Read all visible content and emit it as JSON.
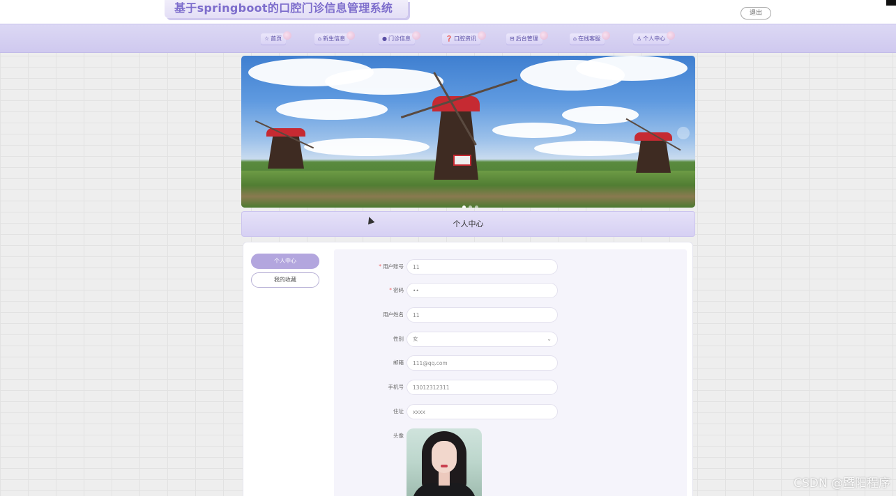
{
  "header": {
    "site_title": "基于springboot的口腔门诊信息管理系统",
    "logout_label": "退出"
  },
  "nav": {
    "items": [
      {
        "icon": "☆",
        "label": "首页"
      },
      {
        "icon": "⌂",
        "label": "新生信息"
      },
      {
        "icon": "●",
        "label": "门诊信息"
      },
      {
        "icon": "❓",
        "label": "口腔资讯"
      },
      {
        "icon": "⊟",
        "label": "后台管理"
      },
      {
        "icon": "⌂",
        "label": "在线客服"
      },
      {
        "icon": "♙",
        "label": "个人中心"
      }
    ]
  },
  "banner": {
    "slide_count": 3,
    "active_slide": 1
  },
  "section": {
    "title": "个人中心"
  },
  "sidebar": {
    "items": [
      {
        "label": "个人中心",
        "active": true
      },
      {
        "label": "我的收藏",
        "active": false
      }
    ]
  },
  "form": {
    "fields": [
      {
        "label": "用户账号",
        "required": true,
        "value": "11"
      },
      {
        "label": "密码",
        "required": true,
        "value": "••"
      },
      {
        "label": "用户姓名",
        "required": false,
        "value": "11"
      },
      {
        "label": "性别",
        "required": false,
        "value": "女"
      },
      {
        "label": "邮箱",
        "required": false,
        "value": "111@qq.com"
      },
      {
        "label": "手机号",
        "required": false,
        "value": "13012312311"
      },
      {
        "label": "住址",
        "required": false,
        "value": "xxxx"
      }
    ],
    "avatar_label": "头像"
  },
  "watermark": "CSDN @暨阳程序"
}
